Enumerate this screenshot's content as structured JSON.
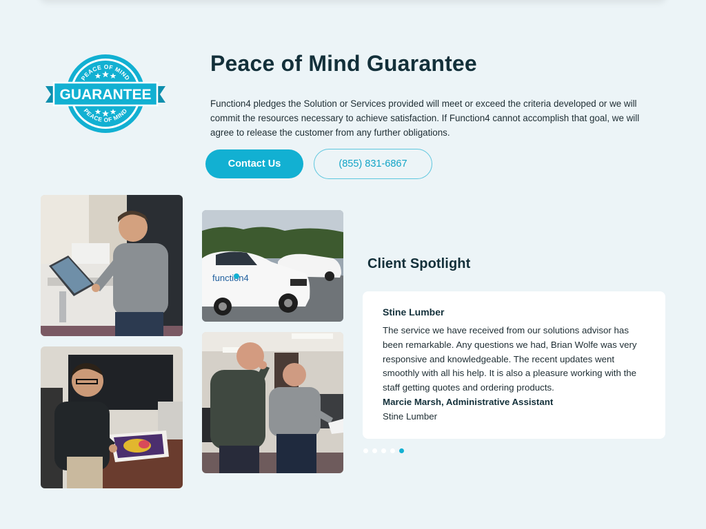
{
  "guarantee": {
    "badge": {
      "arc_top": "PEACE OF MIND",
      "ribbon": "GUARANTEE",
      "arc_bottom": "PEACE OF MIND",
      "color": "#12b0d2"
    },
    "title": "Peace of Mind Guarantee",
    "description": "Function4 pledges the Solution or Services provided will meet or exceed the criteria developed or we will commit the resources necessary to achieve satisfaction. If Function4 cannot accomplish that goal, we will agree to release the customer from any further obligations.",
    "contact_label": "Contact Us",
    "phone_label": "(855) 831-6867"
  },
  "photos": {
    "vehicle_logo": "function4"
  },
  "spotlight": {
    "title": "Client Spotlight",
    "testimonial": {
      "company": "Stine Lumber",
      "quote": "The service we have received from our solutions advisor has been remarkable. Any questions we had, Brian Wolfe was very responsive and knowledgeable. The recent updates went smoothly with all his help. It is also a pleasure working with the staff getting quotes and ordering products.",
      "author": "Marcie Marsh, Administrative Assistant",
      "author_company": "Stine Lumber"
    },
    "carousel": {
      "total": 5,
      "active": 5
    }
  },
  "colors": {
    "accent": "#12b0d2",
    "background": "#ecf4f7",
    "heading": "#13303a"
  }
}
